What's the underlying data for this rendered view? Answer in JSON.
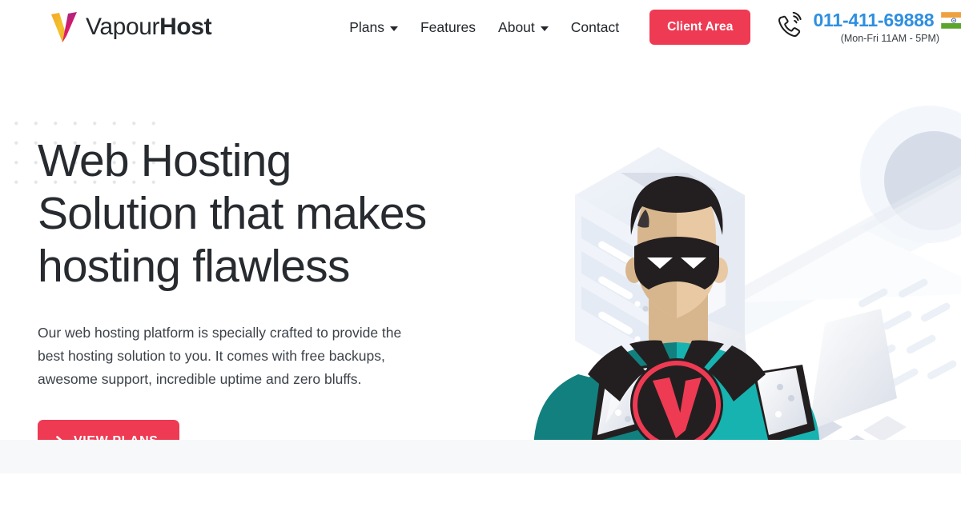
{
  "brand": {
    "name_light": "Vapour",
    "name_bold": "Host",
    "logo_icon": "vapourhost-v-logo-icon"
  },
  "nav": {
    "items": [
      {
        "label": "Plans",
        "has_dropdown": true
      },
      {
        "label": "Features",
        "has_dropdown": false
      },
      {
        "label": "About",
        "has_dropdown": true
      },
      {
        "label": "Contact",
        "has_dropdown": false
      }
    ]
  },
  "header": {
    "client_area_label": "Client Area",
    "phone_icon": "phone-ringing-icon",
    "phone_number": "011-411-69888",
    "phone_hours": "(Mon-Fri 11AM - 5PM)",
    "flag_icon": "india-flag-icon"
  },
  "hero": {
    "title": "Web Hosting\nSolution that makes\nhosting flawless",
    "subtitle": "Our web hosting platform is specially crafted to provide the\nbest hosting solution to you. It comes with free backups,\nawesome support, incredible uptime and zero bluffs.",
    "cta_label": "VIEW PLANS",
    "cta_icon": "chevron-right-icon",
    "illustration_name": "superhero-server-rack-illustration"
  },
  "colors": {
    "accent_red": "#ef3a53",
    "phone_blue": "#2f8fe0",
    "heading_dark": "#272b2f",
    "costume_teal": "#17b3b0",
    "costume_teal_dark": "#12807f",
    "costume_black": "#231f20",
    "skin": "#e8c9a4",
    "skin_dark": "#d8b68d",
    "server_gray": "#e8edf5",
    "dots_gray": "#e3e6ea",
    "strip_gray": "#f7f8fa"
  }
}
